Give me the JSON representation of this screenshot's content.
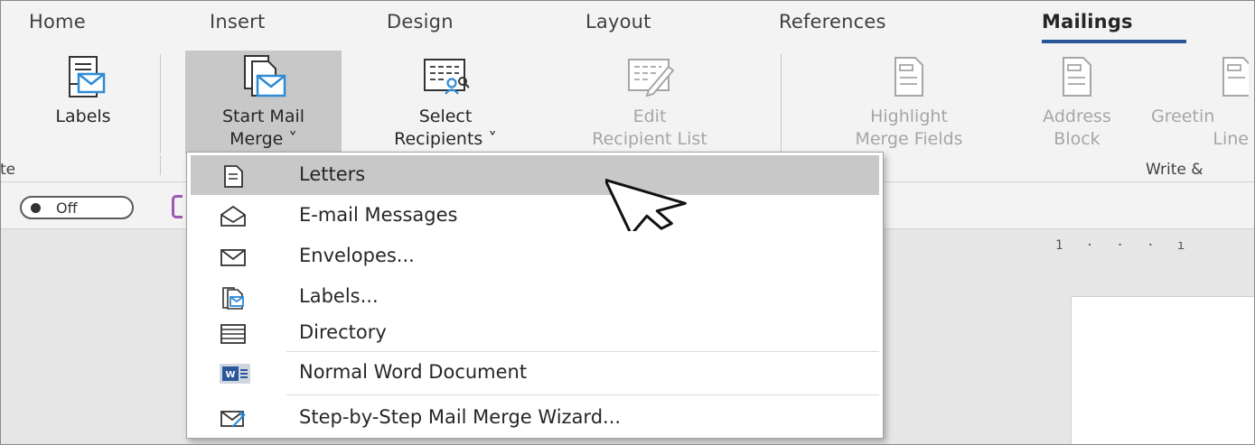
{
  "tabs": [
    {
      "label": "Home",
      "active": false
    },
    {
      "label": "Insert",
      "active": false
    },
    {
      "label": "Design",
      "active": false
    },
    {
      "label": "Layout",
      "active": false
    },
    {
      "label": "References",
      "active": false
    },
    {
      "label": "Mailings",
      "active": true
    }
  ],
  "ribbon": {
    "labels_button": {
      "line1": "Labels",
      "line2": ""
    },
    "start_mail_merge": {
      "line1": "Start Mail",
      "line2": "Merge ˅"
    },
    "select_recipients": {
      "line1": "Select",
      "line2": "Recipients ˅"
    },
    "edit_recipient_list": {
      "line1": "Edit",
      "line2": "Recipient List"
    },
    "highlight_merge_fields": {
      "line1": "Highlight",
      "line2": "Merge Fields"
    },
    "address_block": {
      "line1": "Address",
      "line2": "Block"
    },
    "greeting_line": {
      "line1": "Greetin",
      "line2": "Line"
    },
    "group_left": "te",
    "group_write": "Write &"
  },
  "toolbar": {
    "toggle_label": "Off"
  },
  "ruler": "1   ·   ·   ·   ı",
  "menu": {
    "items": [
      {
        "label": "Letters",
        "icon": "letter-document-icon",
        "hover": true
      },
      {
        "label": "E-mail Messages",
        "icon": "email-envelope-icon",
        "hover": false
      },
      {
        "label": "Envelopes...",
        "icon": "envelope-icon",
        "hover": false
      },
      {
        "label": "Labels...",
        "icon": "labels-icon",
        "hover": false
      },
      {
        "label": "Directory",
        "icon": "directory-icon",
        "hover": false
      },
      {
        "label": "Normal Word Document",
        "icon": "word-document-icon",
        "hover": false
      },
      {
        "label": "Step-by-Step Mail Merge Wizard...",
        "icon": "wizard-icon",
        "hover": false
      }
    ]
  },
  "colors": {
    "accent": "#2b579a",
    "icon_blue": "#2e8bd6",
    "hover": "#c8c8c8",
    "ribbon_bg": "#f3f3f3"
  }
}
